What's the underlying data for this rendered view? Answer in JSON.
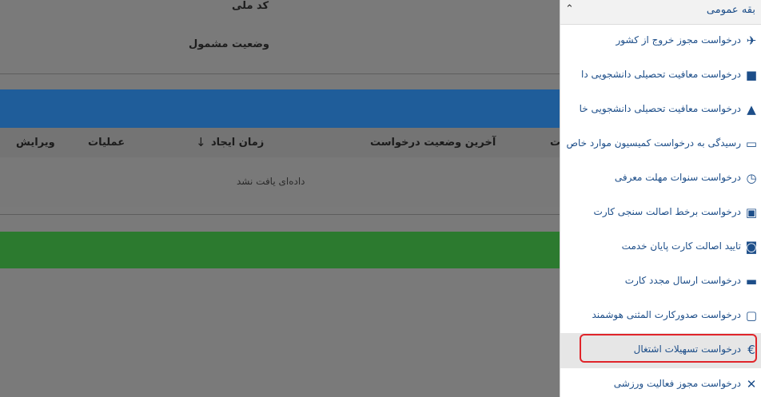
{
  "form": {
    "national_code_label": "کد ملی",
    "status_label": "وضعیت مشمول"
  },
  "table": {
    "headers": {
      "edit": "ویرایش",
      "ops": "عملیات",
      "created": "زمان ایجاد",
      "last_status": "آخرین وضعیت درخواست",
      "cut": "ت"
    },
    "empty_text": "داده‌ای یافت نشد"
  },
  "sidebar": {
    "section_title": "بقه عمومی",
    "items": [
      {
        "label": "درخواست مجوز خروج از کشور",
        "icon": "airplane-icon"
      },
      {
        "label": "درخواست معافیت تحصیلی دانشجویی دا",
        "icon": "book-icon"
      },
      {
        "label": "درخواست معافیت تحصیلی دانشجویی خا",
        "icon": "graduation-cap-icon"
      },
      {
        "label": "رسیدگی به درخواست کمیسیون موارد خاص",
        "icon": "folder-icon"
      },
      {
        "label": "درخواست سنوات مهلت معرفی",
        "icon": "alarm-clock-icon"
      },
      {
        "label": "درخواست برخط اصالت سنجی کارت",
        "icon": "id-card-icon"
      },
      {
        "label": "تایید اصالت کارت پایان خدمت",
        "icon": "search-card-icon"
      },
      {
        "label": "درخواست ارسال مجدد کارت",
        "icon": "truck-icon"
      },
      {
        "label": "درخواست صدورکارت المثنی هوشمند",
        "icon": "monitor-icon"
      },
      {
        "label": "درخواست تسهیلات اشتغال",
        "icon": "euro-icon"
      },
      {
        "label": "درخواست مجوز فعالیت ورزشی",
        "icon": "tools-icon"
      }
    ]
  }
}
